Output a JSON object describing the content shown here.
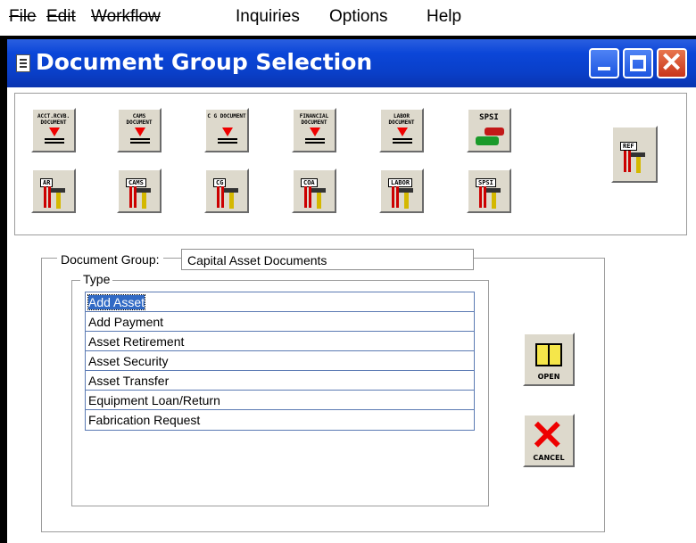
{
  "menu": [
    {
      "label": "File",
      "disabled": true
    },
    {
      "label": "Edit",
      "disabled": true
    },
    {
      "label": "Workflow",
      "disabled": true
    },
    {
      "label": "Inquiries",
      "disabled": false
    },
    {
      "label": "Options",
      "disabled": false
    },
    {
      "label": "Help",
      "disabled": false
    }
  ],
  "window": {
    "title": "Document Group Selection"
  },
  "toolbar": {
    "documents": [
      {
        "label": "ACCT.RCVB. DOCUMENT",
        "name": "ar-document"
      },
      {
        "label": "CAMS DOCUMENT",
        "name": "cams-document"
      },
      {
        "label": "C G DOCUMENT",
        "name": "cg-document"
      },
      {
        "label": "FINANCIAL DOCUMENT",
        "name": "financial-document"
      },
      {
        "label": "LABOR DOCUMENT",
        "name": "labor-document"
      },
      {
        "label": "SPSI",
        "name": "spsi-document"
      }
    ],
    "tools": [
      {
        "label": "AR",
        "name": "ar-tools"
      },
      {
        "label": "CAMS",
        "name": "cams-tools"
      },
      {
        "label": "CG",
        "name": "cg-tools"
      },
      {
        "label": "COA",
        "name": "coa-tools"
      },
      {
        "label": "LABOR",
        "name": "labor-tools"
      },
      {
        "label": "SPSI",
        "name": "spsi-tools"
      }
    ],
    "ref_label": "REF"
  },
  "group": {
    "label": "Document Group:",
    "value": "Capital Asset Documents",
    "type_label": "Type",
    "types": [
      "Add Asset",
      "Add Payment",
      "Asset Retirement",
      "Asset Security",
      "Asset Transfer",
      "Equipment Loan/Return",
      "Fabrication Request"
    ],
    "selected_index": 0
  },
  "buttons": {
    "open": "OPEN",
    "cancel": "CANCEL"
  }
}
